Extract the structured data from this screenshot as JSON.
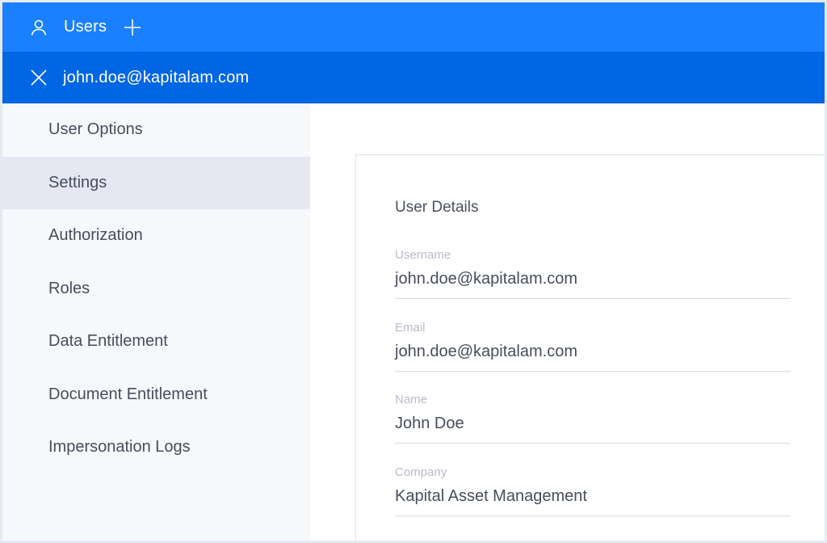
{
  "header": {
    "title": "Users",
    "user_icon": "user-icon",
    "add_icon": "plus-icon"
  },
  "subheader": {
    "close_icon": "close-icon",
    "email": "john.doe@kapitalam.com"
  },
  "sidebar": {
    "items": [
      {
        "label": "User Options"
      },
      {
        "label": "Settings"
      },
      {
        "label": "Authorization"
      },
      {
        "label": "Roles"
      },
      {
        "label": "Data Entitlement"
      },
      {
        "label": "Document Entitlement"
      },
      {
        "label": "Impersonation Logs"
      }
    ],
    "active_index": 1
  },
  "details": {
    "title": "User Details",
    "fields": [
      {
        "label": "Username",
        "value": "john.doe@kapitalam.com"
      },
      {
        "label": "Email",
        "value": "john.doe@kapitalam.com"
      },
      {
        "label": "Name",
        "value": "John Doe"
      },
      {
        "label": "Company",
        "value": "Kapital Asset Management"
      }
    ]
  },
  "colors": {
    "topbar": "#1a80ff",
    "subbar": "#0066e3",
    "sidebar_bg": "#f7f8fc",
    "sidebar_active": "#e5e7f1"
  }
}
